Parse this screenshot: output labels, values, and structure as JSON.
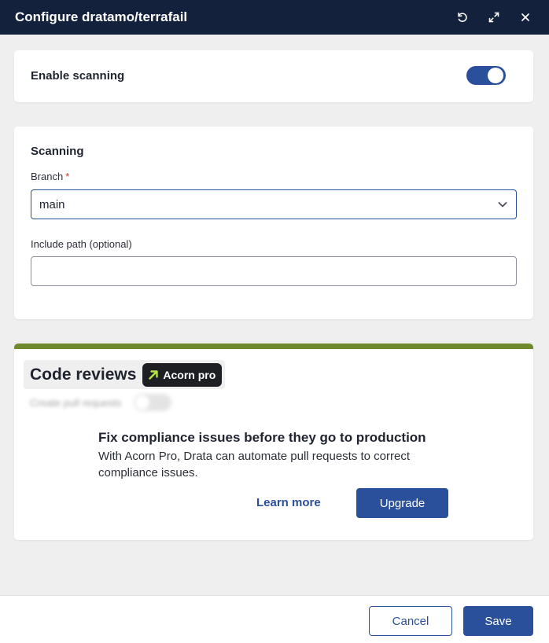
{
  "header": {
    "title": "Configure dratamo/terrafail",
    "icons": [
      "reset-icon",
      "expand-icon",
      "close-icon"
    ]
  },
  "enable_scanning": {
    "label": "Enable scanning",
    "enabled": true
  },
  "scanning": {
    "title": "Scanning",
    "branch_label": "Branch",
    "required_marker": "*",
    "branch_value": "main",
    "include_path_label": "Include path (optional)",
    "include_path_value": ""
  },
  "code_reviews": {
    "title": "Code reviews",
    "badge": "Acorn pro",
    "blurred_label": "Create pull requests",
    "heading": "Fix compliance issues before they go to production",
    "body": "With Acorn Pro, Drata can automate pull requests to correct compliance issues.",
    "learn_more": "Learn more",
    "upgrade": "Upgrade"
  },
  "footer": {
    "cancel": "Cancel",
    "save": "Save"
  },
  "colors": {
    "header_bg": "#14213d",
    "accent": "#2a4f9b",
    "pro_bar": "#6f8a2e",
    "badge_arrow": "#b7e34a"
  }
}
